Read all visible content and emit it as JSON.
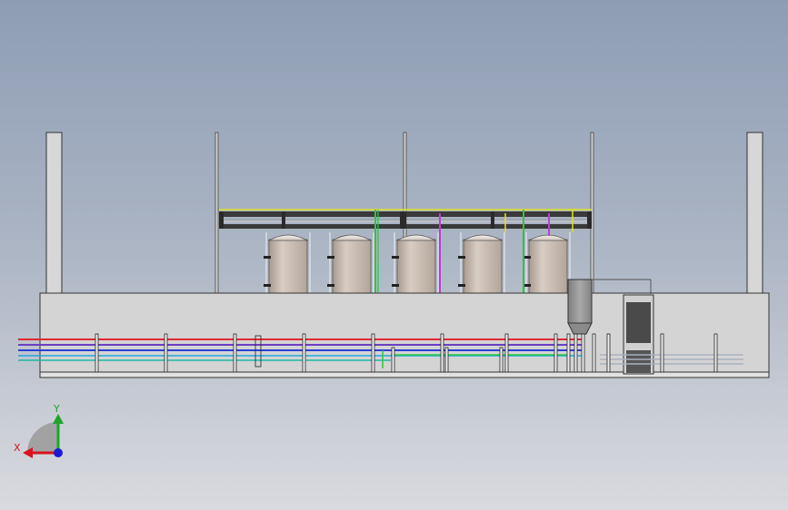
{
  "view": {
    "background_top": "#8e9db4",
    "background_bottom": "#d9dadf"
  },
  "triad": {
    "x_label": "X",
    "y_label": "Y",
    "x_color": "#d8141c",
    "y_color": "#1fa32c",
    "z_color": "#1a1ad6"
  },
  "pipe_colors": {
    "red": "#e0292e",
    "purple": "#6a3fc4",
    "blue": "#2c3fd8",
    "teal": "#1fb5a6",
    "green": "#29c93a",
    "yellow": "#e2e21f",
    "magenta": "#c23ad6"
  },
  "tank_count": 5
}
